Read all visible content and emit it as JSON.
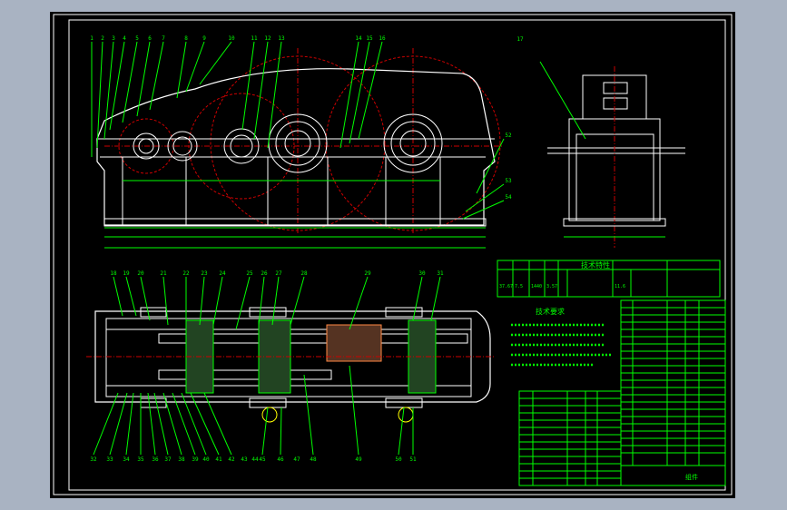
{
  "drawing": {
    "title_tech_char": "技术特性",
    "title_tech_req": "技术要求",
    "leader_labels_top": [
      "1",
      "2",
      "3",
      "4",
      "5",
      "6",
      "7",
      "8",
      "9",
      "10",
      "11",
      "12",
      "13",
      "14",
      "15",
      "16"
    ],
    "leader_labels_side": [
      "17",
      "52",
      "53",
      "54"
    ],
    "leader_labels_plan_top": [
      "18",
      "19",
      "20",
      "21",
      "22",
      "23",
      "24",
      "25",
      "26",
      "27",
      "28",
      "29",
      "30",
      "31"
    ],
    "leader_labels_plan_bottom": [
      "32",
      "33",
      "34",
      "35",
      "36",
      "37",
      "38",
      "39",
      "40",
      "41",
      "42",
      "43",
      "44",
      "45",
      "46",
      "47",
      "48",
      "49",
      "50",
      "51"
    ],
    "tech_char_values": [
      "37.67",
      "7.5",
      "1440",
      "3.57",
      "11.6"
    ],
    "title_block_text": "组件"
  },
  "colors": {
    "background": "#000000",
    "outline": "#ffffff",
    "green": "#00ff00",
    "gear_red": "#cc0000",
    "magenta": "#ff00ff",
    "cyan": "#00ffff"
  }
}
